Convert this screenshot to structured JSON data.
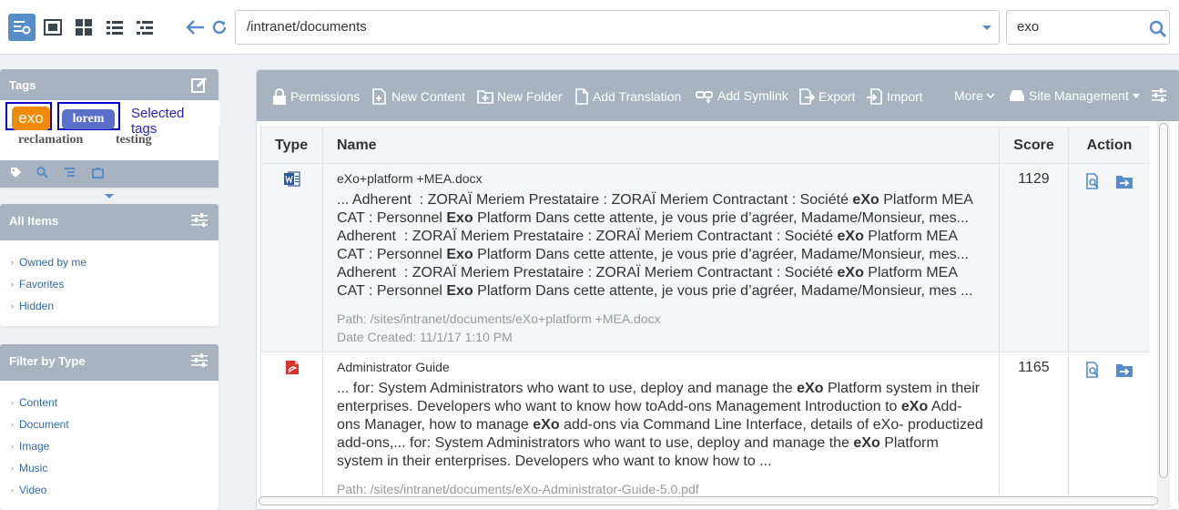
{
  "toolbar": {
    "views": [
      "admin-view-icon",
      "icon-view-icon",
      "thumbnail-view-icon",
      "list-view-icon",
      "tree-view-icon"
    ],
    "path": "/intranet/documents",
    "search_value": "exo"
  },
  "tags_panel": {
    "title": "Tags",
    "tags": [
      "exo",
      "lorem",
      "reclamation",
      "testing"
    ],
    "selected_label": "Selected tags"
  },
  "all_items": {
    "title": "All Items",
    "items": [
      "Owned by me",
      "Favorites",
      "Hidden"
    ]
  },
  "filter_by_type": {
    "title": "Filter by Type",
    "items": [
      "Content",
      "Document",
      "Image",
      "Music",
      "Video"
    ]
  },
  "actions": {
    "permissions": "Permissions",
    "new_content": "New Content",
    "new_folder": "New Folder",
    "add_translation": "Add Translation",
    "add_symlink": "Add Symlink",
    "export": "Export",
    "import": "Import",
    "more": "More",
    "site_management": "Site Management"
  },
  "table": {
    "headers": {
      "type": "Type",
      "name": "Name",
      "score": "Score",
      "action": "Action"
    },
    "rows": [
      {
        "type_icon": "word-doc-icon",
        "title": "eXo+platform +MEA.docx",
        "excerpt_html": "... Adherent &nbsp;: ZORAÏ Meriem Prestataire : ZORAÏ Meriem Contractant : Société <b>eXo</b> Platform MEA CAT : Personnel <b>Exo</b> Platform Dans cette attente, je vous prie d’agréer, Madame/Monsieur, mes... Adherent &nbsp;: ZORAÏ Meriem Prestataire : ZORAÏ Meriem Contractant : Société <b>eXo</b> Platform MEA CAT : Personnel <b>Exo</b> Platform Dans cette attente, je vous prie d’agréer, Madame/Monsieur, mes... Adherent &nbsp;: ZORAÏ Meriem Prestataire : ZORAÏ Meriem Contractant : Société <b>eXo</b> Platform MEA CAT : Personnel <b>Exo</b> Platform Dans cette attente, je vous prie d’agréer, Madame/Monsieur, mes ...",
        "path": "Path: /sites/intranet/documents/eXo+platform +MEA.docx",
        "date": "Date Created: 11/1/17 1:10 PM",
        "score": "1129"
      },
      {
        "type_icon": "pdf-doc-icon",
        "title": "Administrator Guide",
        "excerpt_html": "... for: System Administrators who want to use, deploy and manage the <b>eXo</b> Platform system in their enterprises. Developers who want to know how toAdd-ons Management Introduction to <b>eXo</b> Add-ons Manager, how to manage <b>eXo</b> add-ons via Command Line Interface, details of eXo- productized add-ons,... for: System Administrators who want to use, deploy and manage the <b>eXo</b> Platform system in their enterprises. Developers who want to know how to ...",
        "path": "Path: /sites/intranet/documents/eXo-Administrator-Guide-5.0.pdf",
        "score": "1165"
      }
    ]
  },
  "colors": {
    "accent": "#578dc9",
    "panel_header": "#a8b3c2",
    "tag_exo": "#f08a07",
    "tag_lorem": "#5a6fc7"
  }
}
